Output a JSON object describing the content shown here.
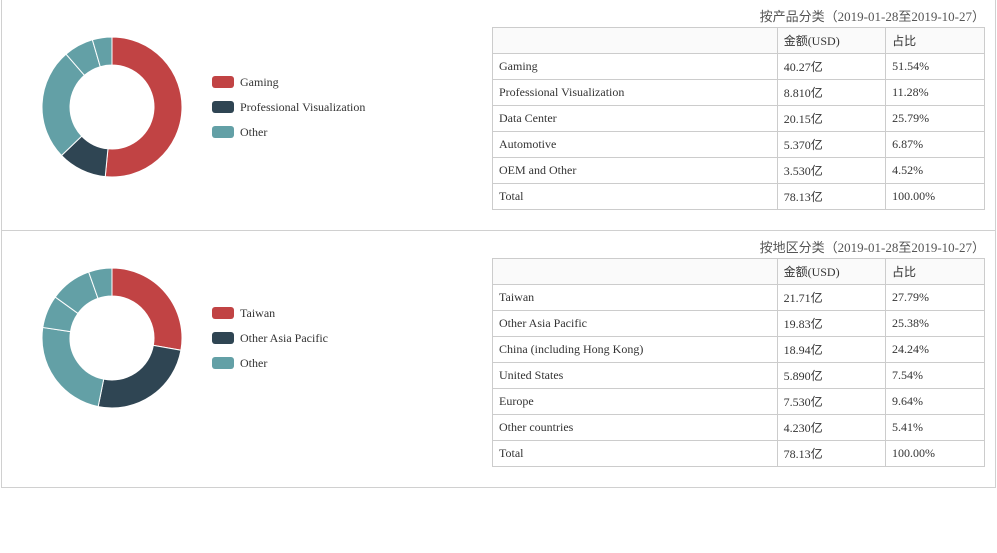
{
  "chart_data": [
    {
      "type": "pie",
      "title": "按产品分类（2019-01-28至2019-10-27）",
      "series": [
        {
          "name": "Gaming",
          "value": 51.54,
          "color": "#c14344"
        },
        {
          "name": "Professional Visualization",
          "value": 11.28,
          "color": "#2f4553"
        },
        {
          "name": "Data Center",
          "value": 25.79,
          "color": "#63a0a6"
        },
        {
          "name": "Automotive",
          "value": 6.87,
          "color": "#63a0a6"
        },
        {
          "name": "OEM and Other",
          "value": 4.52,
          "color": "#63a0a6"
        }
      ],
      "legend": [
        {
          "label": "Gaming",
          "color": "#c14344"
        },
        {
          "label": "Professional Visualization",
          "color": "#2f4553"
        },
        {
          "label": "Other",
          "color": "#63a0a6"
        }
      ]
    },
    {
      "type": "pie",
      "title": "按地区分类（2019-01-28至2019-10-27）",
      "series": [
        {
          "name": "Taiwan",
          "value": 27.79,
          "color": "#c14344"
        },
        {
          "name": "Other Asia Pacific",
          "value": 25.38,
          "color": "#2f4553"
        },
        {
          "name": "China (including Hong Kong)",
          "value": 24.24,
          "color": "#63a0a6"
        },
        {
          "name": "United States",
          "value": 7.54,
          "color": "#63a0a6"
        },
        {
          "name": "Europe",
          "value": 9.64,
          "color": "#63a0a6"
        },
        {
          "name": "Other countries",
          "value": 5.41,
          "color": "#63a0a6"
        }
      ],
      "legend": [
        {
          "label": "Taiwan",
          "color": "#c14344"
        },
        {
          "label": "Other Asia Pacific",
          "color": "#2f4553"
        },
        {
          "label": "Other",
          "color": "#63a0a6"
        }
      ]
    }
  ],
  "tables": [
    {
      "headers": [
        "",
        "金额(USD)",
        "占比"
      ],
      "rows": [
        [
          "Gaming",
          "40.27亿",
          "51.54%"
        ],
        [
          "Professional Visualization",
          "8.810亿",
          "11.28%"
        ],
        [
          "Data Center",
          "20.15亿",
          "25.79%"
        ],
        [
          "Automotive",
          "5.370亿",
          "6.87%"
        ],
        [
          "OEM and Other",
          "3.530亿",
          "4.52%"
        ],
        [
          "Total",
          "78.13亿",
          "100.00%"
        ]
      ]
    },
    {
      "headers": [
        "",
        "金额(USD)",
        "占比"
      ],
      "rows": [
        [
          "Taiwan",
          "21.71亿",
          "27.79%"
        ],
        [
          "Other Asia Pacific",
          "19.83亿",
          "25.38%"
        ],
        [
          "China (including Hong Kong)",
          "18.94亿",
          "24.24%"
        ],
        [
          "United States",
          "5.890亿",
          "7.54%"
        ],
        [
          "Europe",
          "7.530亿",
          "9.64%"
        ],
        [
          "Other countries",
          "4.230亿",
          "5.41%"
        ],
        [
          "Total",
          "78.13亿",
          "100.00%"
        ]
      ]
    }
  ]
}
